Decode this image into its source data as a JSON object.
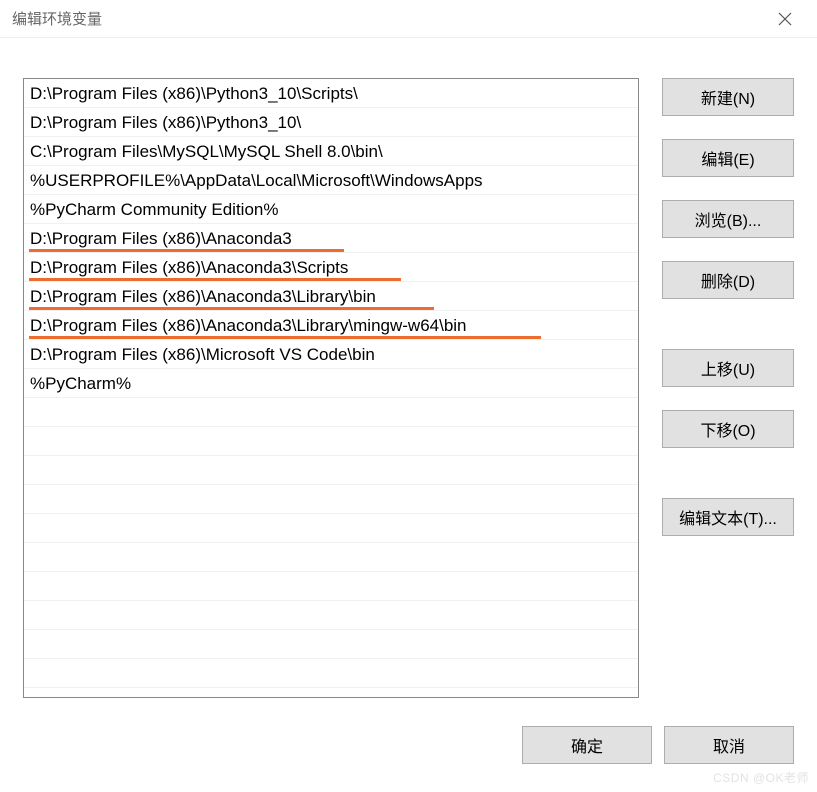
{
  "titlebar": {
    "title": "编辑环境变量"
  },
  "list": {
    "items": [
      {
        "text": "D:\\Program Files (x86)\\Python3_10\\Scripts\\",
        "underlined": false
      },
      {
        "text": "D:\\Program Files (x86)\\Python3_10\\",
        "underlined": false
      },
      {
        "text": "C:\\Program Files\\MySQL\\MySQL Shell 8.0\\bin\\",
        "underlined": false
      },
      {
        "text": "%USERPROFILE%\\AppData\\Local\\Microsoft\\WindowsApps",
        "underlined": false
      },
      {
        "text": "%PyCharm Community Edition%",
        "underlined": false
      },
      {
        "text": "D:\\Program Files (x86)\\Anaconda3",
        "underlined": true,
        "underline_width": 315
      },
      {
        "text": "D:\\Program Files (x86)\\Anaconda3\\Scripts",
        "underlined": true,
        "underline_width": 372
      },
      {
        "text": "D:\\Program Files (x86)\\Anaconda3\\Library\\bin",
        "underlined": true,
        "underline_width": 405
      },
      {
        "text": "D:\\Program Files (x86)\\Anaconda3\\Library\\mingw-w64\\bin",
        "underlined": true,
        "underline_width": 512
      },
      {
        "text": "D:\\Program Files (x86)\\Microsoft VS Code\\bin",
        "underlined": false
      },
      {
        "text": "%PyCharm%",
        "underlined": false
      }
    ],
    "visible_empty_rows": 10
  },
  "buttons": {
    "new": "新建(N)",
    "edit": "编辑(E)",
    "browse": "浏览(B)...",
    "delete": "删除(D)",
    "moveup": "上移(U)",
    "movedown": "下移(O)",
    "edit_text": "编辑文本(T)...",
    "ok": "确定",
    "cancel": "取消"
  },
  "watermark": "CSDN @OK老师"
}
